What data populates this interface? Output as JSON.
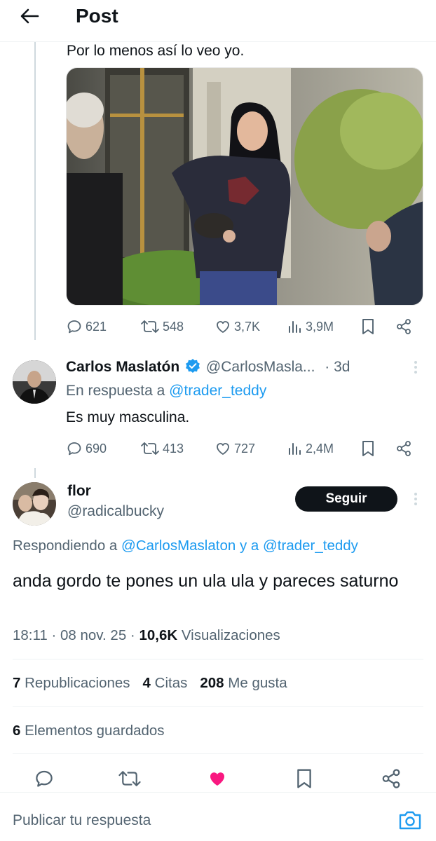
{
  "header": {
    "title": "Post"
  },
  "tweet1": {
    "text": "Por lo menos así lo veo yo.",
    "stats": {
      "replies": "621",
      "reposts": "548",
      "likes": "3,7K",
      "views": "3,9M"
    }
  },
  "tweet2": {
    "name": "Carlos Maslatón",
    "handle": "@CarlosMasla...",
    "sep": "·",
    "time": "3d",
    "reply_prefix": "En respuesta a ",
    "reply_to": "@trader_teddy",
    "text": "Es muy masculina.",
    "stats": {
      "replies": "690",
      "reposts": "413",
      "likes": "727",
      "views": "2,4M"
    }
  },
  "main": {
    "name": "flor",
    "handle": "@radicalbucky",
    "follow_label": "Seguir",
    "replying_prefix": "Respondiendo a ",
    "replying_user1": "@CarlosMaslaton",
    "replying_and": " y a ",
    "replying_user2": "@trader_teddy",
    "text": "anda gordo te pones un ula ula y pareces saturno",
    "time": "18:11",
    "date": "08 nov. 25",
    "views_count": "10,6K",
    "views_label": "Visualizaciones",
    "reposts_count": "7",
    "reposts_label": "Republicaciones",
    "quotes_count": "4",
    "quotes_label": "Citas",
    "likes_count": "208",
    "likes_label": "Me gusta",
    "bookmarks_count": "6",
    "bookmarks_label": "Elementos guardados"
  },
  "reply_bar": {
    "placeholder": "Publicar tu respuesta"
  },
  "colors": {
    "accent": "#1d9bf0",
    "like": "#f91880",
    "text": "#0f1419",
    "muted": "#536471"
  },
  "icons": [
    "back-arrow-icon",
    "reply-icon",
    "repost-icon",
    "like-icon",
    "views-icon",
    "bookmark-icon",
    "share-icon",
    "verified-icon",
    "more-icon",
    "camera-icon"
  ]
}
